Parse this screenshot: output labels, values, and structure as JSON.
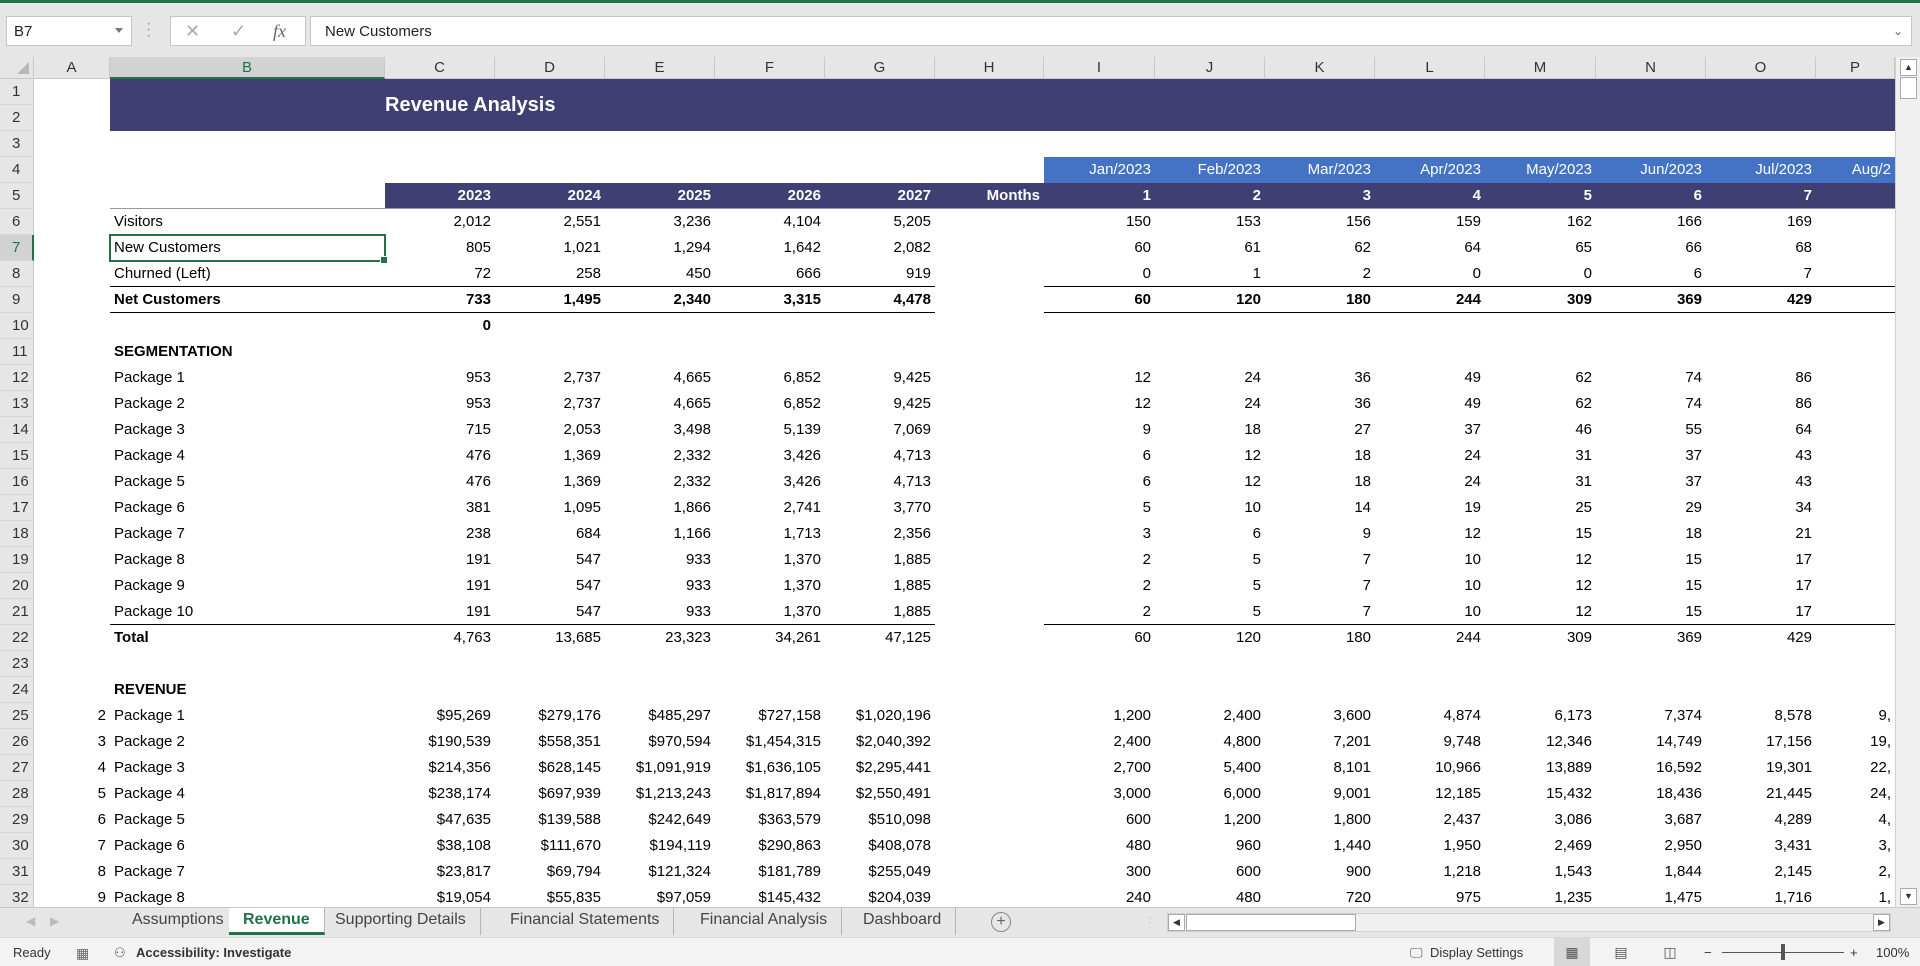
{
  "app": {
    "accent": "#217346",
    "title_band_color": "#3f3f73",
    "month_band_color": "#4472c4"
  },
  "formula_bar": {
    "name_box": "B7",
    "cancel_icon": "✕",
    "enter_icon": "✓",
    "fx_icon": "fx",
    "formula": "New Customers"
  },
  "columns": [
    "A",
    "B",
    "C",
    "D",
    "E",
    "F",
    "G",
    "H",
    "I",
    "J",
    "K",
    "L",
    "M",
    "N",
    "O",
    "P"
  ],
  "rows": [
    "1",
    "2",
    "3",
    "4",
    "5",
    "6",
    "7",
    "8",
    "9",
    "10",
    "11",
    "12",
    "13",
    "14",
    "15",
    "16",
    "17",
    "18",
    "19",
    "20",
    "21",
    "22",
    "23",
    "24",
    "25",
    "26",
    "27",
    "28",
    "29",
    "30",
    "31",
    "32"
  ],
  "sheet": {
    "title": "Revenue Analysis",
    "years": [
      "2023",
      "2024",
      "2025",
      "2026",
      "2027"
    ],
    "months_label": "Months",
    "month_dates": [
      "Jan/2023",
      "Feb/2023",
      "Mar/2023",
      "Apr/2023",
      "May/2023",
      "Jun/2023",
      "Jul/2023",
      "Aug/2"
    ],
    "month_numbers": [
      "1",
      "2",
      "3",
      "4",
      "5",
      "6",
      "7"
    ],
    "customers": [
      {
        "label": "Visitors",
        "annual": [
          "2,012",
          "2,551",
          "3,236",
          "4,104",
          "5,205"
        ],
        "monthly": [
          "150",
          "153",
          "156",
          "159",
          "162",
          "166",
          "169"
        ]
      },
      {
        "label": "New Customers",
        "annual": [
          "805",
          "1,021",
          "1,294",
          "1,642",
          "2,082"
        ],
        "monthly": [
          "60",
          "61",
          "62",
          "64",
          "65",
          "66",
          "68"
        ]
      },
      {
        "label": "Churned (Left)",
        "annual": [
          "72",
          "258",
          "450",
          "666",
          "919"
        ],
        "monthly": [
          "0",
          "1",
          "2",
          "0",
          "0",
          "6",
          "7"
        ]
      }
    ],
    "net_customers": {
      "label": "Net Customers",
      "annual": [
        "733",
        "1,495",
        "2,340",
        "3,315",
        "4,478"
      ],
      "monthly": [
        "60",
        "120",
        "180",
        "244",
        "309",
        "369",
        "429"
      ]
    },
    "row10_value": "0",
    "segmentation_header": "SEGMENTATION",
    "segmentation": [
      {
        "label": "Package 1",
        "annual": [
          "953",
          "2,737",
          "4,665",
          "6,852",
          "9,425"
        ],
        "monthly": [
          "12",
          "24",
          "36",
          "49",
          "62",
          "74",
          "86"
        ]
      },
      {
        "label": "Package 2",
        "annual": [
          "953",
          "2,737",
          "4,665",
          "6,852",
          "9,425"
        ],
        "monthly": [
          "12",
          "24",
          "36",
          "49",
          "62",
          "74",
          "86"
        ]
      },
      {
        "label": "Package 3",
        "annual": [
          "715",
          "2,053",
          "3,498",
          "5,139",
          "7,069"
        ],
        "monthly": [
          "9",
          "18",
          "27",
          "37",
          "46",
          "55",
          "64"
        ]
      },
      {
        "label": "Package 4",
        "annual": [
          "476",
          "1,369",
          "2,332",
          "3,426",
          "4,713"
        ],
        "monthly": [
          "6",
          "12",
          "18",
          "24",
          "31",
          "37",
          "43"
        ]
      },
      {
        "label": "Package 5",
        "annual": [
          "476",
          "1,369",
          "2,332",
          "3,426",
          "4,713"
        ],
        "monthly": [
          "6",
          "12",
          "18",
          "24",
          "31",
          "37",
          "43"
        ]
      },
      {
        "label": "Package 6",
        "annual": [
          "381",
          "1,095",
          "1,866",
          "2,741",
          "3,770"
        ],
        "monthly": [
          "5",
          "10",
          "14",
          "19",
          "25",
          "29",
          "34"
        ]
      },
      {
        "label": "Package 7",
        "annual": [
          "238",
          "684",
          "1,166",
          "1,713",
          "2,356"
        ],
        "monthly": [
          "3",
          "6",
          "9",
          "12",
          "15",
          "18",
          "21"
        ]
      },
      {
        "label": "Package 8",
        "annual": [
          "191",
          "547",
          "933",
          "1,370",
          "1,885"
        ],
        "monthly": [
          "2",
          "5",
          "7",
          "10",
          "12",
          "15",
          "17"
        ]
      },
      {
        "label": "Package 9",
        "annual": [
          "191",
          "547",
          "933",
          "1,370",
          "1,885"
        ],
        "monthly": [
          "2",
          "5",
          "7",
          "10",
          "12",
          "15",
          "17"
        ]
      },
      {
        "label": "Package 10",
        "annual": [
          "191",
          "547",
          "933",
          "1,370",
          "1,885"
        ],
        "monthly": [
          "2",
          "5",
          "7",
          "10",
          "12",
          "15",
          "17"
        ]
      }
    ],
    "segmentation_total": {
      "label": "Total",
      "annual": [
        "4,763",
        "13,685",
        "23,323",
        "34,261",
        "47,125"
      ],
      "monthly": [
        "60",
        "120",
        "180",
        "244",
        "309",
        "369",
        "429"
      ]
    },
    "revenue_header": "REVENUE",
    "revenue": [
      {
        "index": "2",
        "label": "Package 1",
        "annual": [
          "$95,269",
          "$279,176",
          "$485,297",
          "$727,158",
          "$1,020,196"
        ],
        "monthly": [
          "1,200",
          "2,400",
          "3,600",
          "4,874",
          "6,173",
          "7,374",
          "8,578",
          "9,"
        ]
      },
      {
        "index": "3",
        "label": "Package 2",
        "annual": [
          "$190,539",
          "$558,351",
          "$970,594",
          "$1,454,315",
          "$2,040,392"
        ],
        "monthly": [
          "2,400",
          "4,800",
          "7,201",
          "9,748",
          "12,346",
          "14,749",
          "17,156",
          "19,"
        ]
      },
      {
        "index": "4",
        "label": "Package 3",
        "annual": [
          "$214,356",
          "$628,145",
          "$1,091,919",
          "$1,636,105",
          "$2,295,441"
        ],
        "monthly": [
          "2,700",
          "5,400",
          "8,101",
          "10,966",
          "13,889",
          "16,592",
          "19,301",
          "22,"
        ]
      },
      {
        "index": "5",
        "label": "Package 4",
        "annual": [
          "$238,174",
          "$697,939",
          "$1,213,243",
          "$1,817,894",
          "$2,550,491"
        ],
        "monthly": [
          "3,000",
          "6,000",
          "9,001",
          "12,185",
          "15,432",
          "18,436",
          "21,445",
          "24,"
        ]
      },
      {
        "index": "6",
        "label": "Package 5",
        "annual": [
          "$47,635",
          "$139,588",
          "$242,649",
          "$363,579",
          "$510,098"
        ],
        "monthly": [
          "600",
          "1,200",
          "1,800",
          "2,437",
          "3,086",
          "3,687",
          "4,289",
          "4,"
        ]
      },
      {
        "index": "7",
        "label": "Package 6",
        "annual": [
          "$38,108",
          "$111,670",
          "$194,119",
          "$290,863",
          "$408,078"
        ],
        "monthly": [
          "480",
          "960",
          "1,440",
          "1,950",
          "2,469",
          "2,950",
          "3,431",
          "3,"
        ]
      },
      {
        "index": "8",
        "label": "Package 7",
        "annual": [
          "$23,817",
          "$69,794",
          "$121,324",
          "$181,789",
          "$255,049"
        ],
        "monthly": [
          "300",
          "600",
          "900",
          "1,218",
          "1,543",
          "1,844",
          "2,145",
          "2,"
        ]
      },
      {
        "index": "9",
        "label": "Package 8",
        "annual": [
          "$19,054",
          "$55,835",
          "$97,059",
          "$145,432",
          "$204,039"
        ],
        "monthly": [
          "240",
          "480",
          "720",
          "975",
          "1,235",
          "1,475",
          "1,716",
          "1,"
        ]
      }
    ]
  },
  "tabs": [
    {
      "label": "Assumptions",
      "active": false
    },
    {
      "label": "Revenue",
      "active": true
    },
    {
      "label": "Supporting Details",
      "active": false
    },
    {
      "label": "Financial Statements",
      "active": false
    },
    {
      "label": "Financial Analysis",
      "active": false
    },
    {
      "label": "Dashboard",
      "active": false
    }
  ],
  "add_sheet_icon": "+",
  "status": {
    "ready": "Ready",
    "accessibility": "Accessibility: Investigate",
    "display_settings": "Display Settings",
    "zoom_minus": "−",
    "zoom_plus": "+",
    "zoom_level": "100%",
    "zoom_fraction": 0.5
  }
}
